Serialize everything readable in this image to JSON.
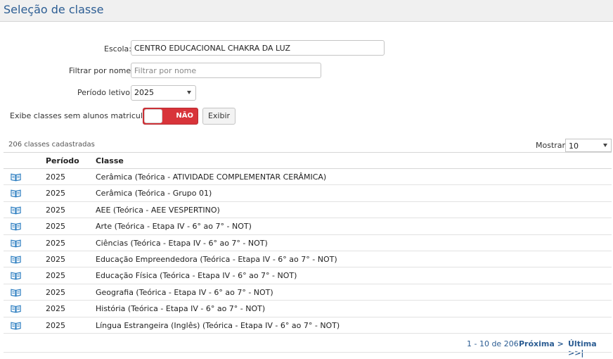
{
  "page": {
    "title": "Seleção de classe"
  },
  "filters": {
    "escola_label": "Escola:",
    "escola_value": "CENTRO EDUCACIONAL CHAKRA DA LUZ",
    "nome_label": "Filtrar por nome:",
    "nome_placeholder": "Filtrar por nome",
    "periodo_label": "Período letivo:",
    "periodo_value": "2025",
    "sem_alunos_label": "Exibe classes sem alunos matriculados:",
    "toggle_state": "NÃO",
    "exibir_label": "Exibir"
  },
  "list": {
    "count_text": "206 classes cadastradas",
    "show_label": "Mostrar:",
    "show_value": "10",
    "columns": [
      "Período",
      "Classe"
    ],
    "rows": [
      {
        "periodo": "2025",
        "classe": "Cerâmica (Teórica - ATIVIDADE COMPLEMENTAR CERÂMICA)"
      },
      {
        "periodo": "2025",
        "classe": "Cerâmica (Teórica - Grupo 01)"
      },
      {
        "periodo": "2025",
        "classe": "AEE (Teórica - AEE VESPERTINO)"
      },
      {
        "periodo": "2025",
        "classe": "Arte (Teórica - Etapa IV - 6° ao 7° - NOT)"
      },
      {
        "periodo": "2025",
        "classe": "Ciências (Teórica - Etapa IV - 6° ao 7° - NOT)"
      },
      {
        "periodo": "2025",
        "classe": "Educação Empreendedora (Teórica - Etapa IV - 6° ao 7° - NOT)"
      },
      {
        "periodo": "2025",
        "classe": "Educação Física (Teórica - Etapa IV - 6° ao 7° - NOT)"
      },
      {
        "periodo": "2025",
        "classe": "Geografia (Teórica - Etapa IV - 6° ao 7° - NOT)"
      },
      {
        "periodo": "2025",
        "classe": "História (Teórica - Etapa IV - 6° ao 7° - NOT)"
      },
      {
        "periodo": "2025",
        "classe": "Língua Estrangeira (Inglês) (Teórica - Etapa IV - 6° ao 7° - NOT)"
      }
    ]
  },
  "pager": {
    "range_text": "1 - 10 de 206",
    "next_label": "Próxima >",
    "last_label": "Última >>|"
  },
  "colors": {
    "accent": "#2c5d93",
    "toggle_off": "#d8343a",
    "icon": "#2f7fc1"
  }
}
